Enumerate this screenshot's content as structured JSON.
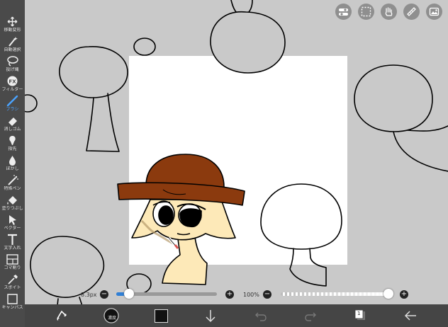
{
  "toolbar": {
    "tools": [
      {
        "label": "移動変形",
        "icon": "move-icon"
      },
      {
        "label": "自動選択",
        "icon": "magic-wand-icon"
      },
      {
        "label": "投げ縄",
        "icon": "lasso-icon"
      },
      {
        "label": "フィルター",
        "icon": "fx-icon"
      },
      {
        "label": "ブラシ",
        "icon": "brush-icon",
        "active": true
      },
      {
        "label": "消しゴム",
        "icon": "eraser-icon"
      },
      {
        "label": "指先",
        "icon": "smudge-icon"
      },
      {
        "label": "ぼかし",
        "icon": "blur-drop-icon"
      },
      {
        "label": "特殊ペン",
        "icon": "special-pen-icon"
      },
      {
        "label": "塗りつぶし",
        "icon": "fill-bucket-icon"
      },
      {
        "label": "ベクター",
        "icon": "vector-arrow-icon"
      },
      {
        "label": "文字入れ",
        "icon": "text-icon"
      },
      {
        "label": "コマ割り",
        "icon": "frame-divide-icon"
      },
      {
        "label": "スポイト",
        "icon": "eyedropper-icon"
      },
      {
        "label": "キャンバス",
        "icon": "canvas-icon"
      }
    ]
  },
  "controls": {
    "brush_size": "8.3px",
    "brush_size_fraction": 0.13,
    "opacity": "100%",
    "opacity_fraction": 1.0
  },
  "bottom_bar": {
    "brush_sample_label": "濃度",
    "layer_count": "1",
    "current_color": "#111111"
  },
  "colors": {
    "toolbar_bg": "#4a4a4a",
    "active_tool": "#4aa3ff",
    "hat_brown": "#8b3a0e",
    "skin": "#fde9b8"
  }
}
